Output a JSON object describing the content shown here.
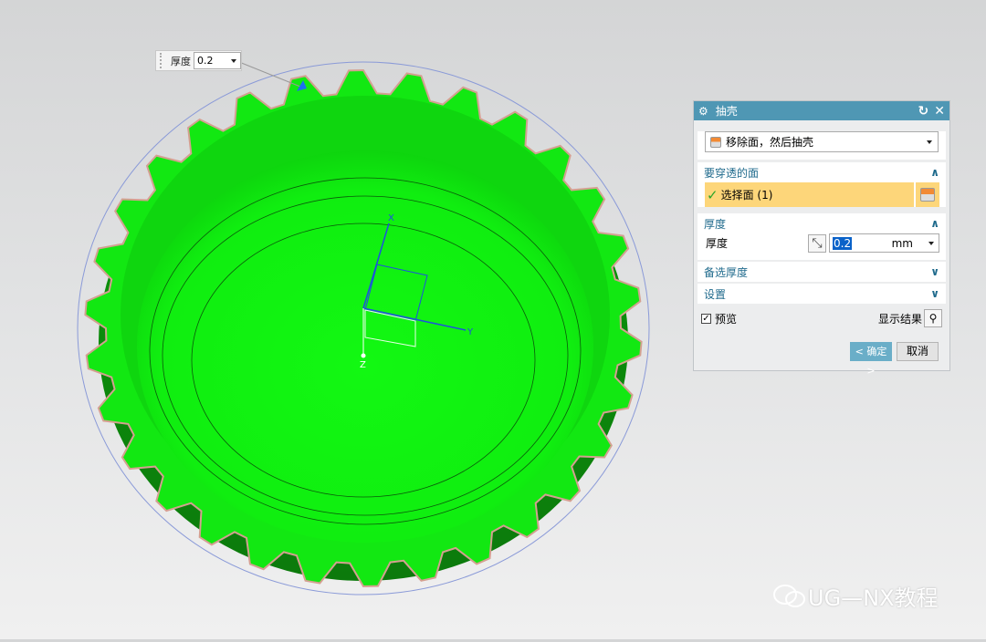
{
  "viewport": {
    "thickness_tag": {
      "label": "厚度",
      "value": "0.2"
    },
    "axes": {
      "x": "X",
      "y": "Y",
      "z": "Z"
    },
    "colors": {
      "body": "#10f010",
      "dark": "#0a8c0a",
      "edge": "#d4a090"
    }
  },
  "dialog": {
    "title": "抽壳",
    "type_option": "移除面，然后抽壳",
    "section_faces": {
      "title": "要穿透的面",
      "select_label": "选择面 (1)"
    },
    "section_thickness": {
      "title": "厚度",
      "label": "厚度",
      "value": "0.2",
      "unit": "mm"
    },
    "section_alt": {
      "title": "备选厚度"
    },
    "section_settings": {
      "title": "设置"
    },
    "preview_label": "预览",
    "preview_checked": true,
    "show_result_label": "显示结果",
    "ok_label": "< 确定 >",
    "cancel_label": "取消"
  },
  "watermark": {
    "text": "UG—NX教程"
  }
}
